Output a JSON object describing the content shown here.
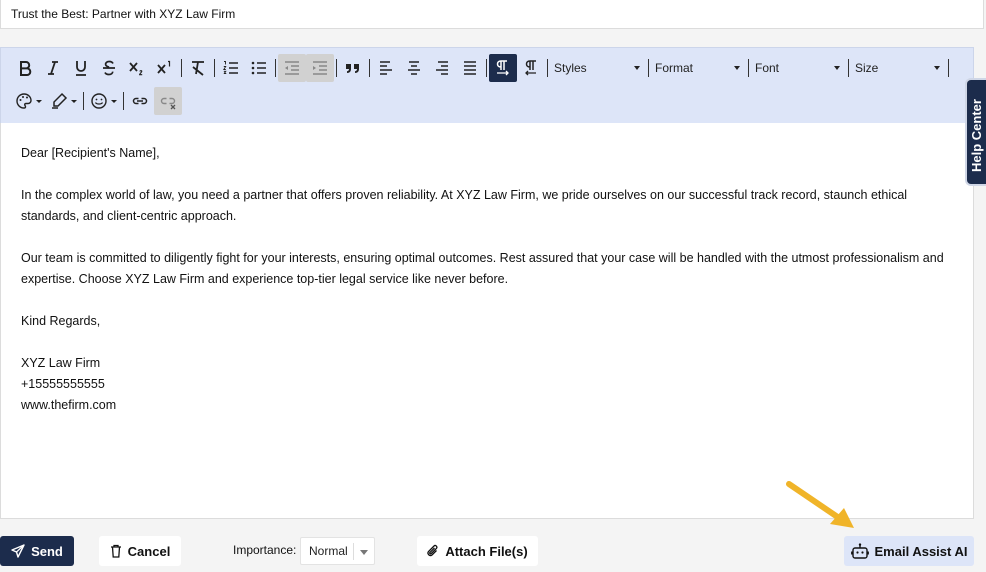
{
  "subject": {
    "value": "Trust the Best: Partner with XYZ Law Firm"
  },
  "toolbar": {
    "styles_label": "Styles",
    "format_label": "Format",
    "font_label": "Font",
    "size_label": "Size"
  },
  "body": {
    "greeting": "Dear [Recipient's Name],",
    "paragraph1": "In the complex world of law, you need a partner that offers proven reliability. At XYZ Law Firm, we pride ourselves on our successful track record, staunch ethical standards, and client-centric approach.",
    "paragraph2": "Our team is committed to diligently fight for your interests, ensuring optimal outcomes. Rest assured that your case will be handled with the utmost professionalism and expertise. Choose XYZ Law Firm and experience top-tier legal service like never before.",
    "closing": "Kind Regards,",
    "signature_name": "XYZ Law Firm",
    "signature_phone": "+15555555555",
    "signature_web": "www.thefirm.com"
  },
  "help_center": {
    "label": "Help Center"
  },
  "footer": {
    "send_label": "Send",
    "cancel_label": "Cancel",
    "importance_label": "Importance:",
    "importance_value": "Normal",
    "attach_label": "Attach File(s)",
    "assist_label": "Email Assist AI"
  },
  "colors": {
    "navy": "#1c2c4c",
    "toolbar_bg": "#dde5f8",
    "arrow": "#f0b429"
  }
}
